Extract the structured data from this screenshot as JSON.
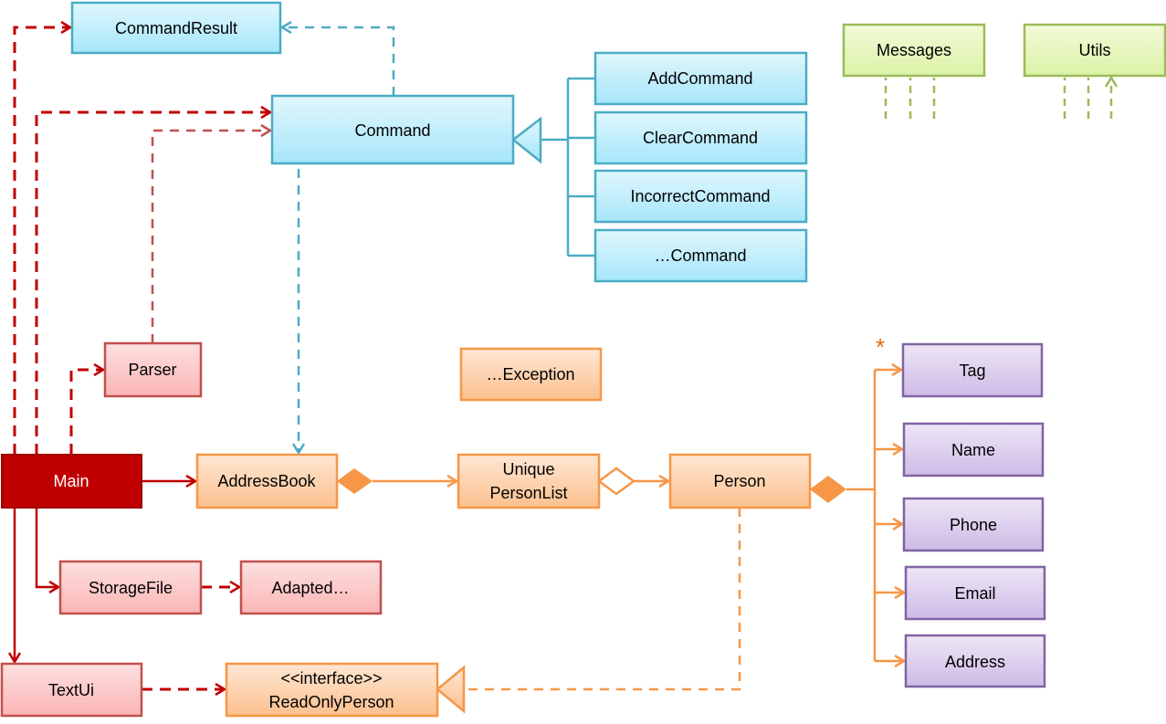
{
  "classes": {
    "command_result": "CommandResult",
    "command": "Command",
    "add_command": "AddCommand",
    "clear_command": "ClearCommand",
    "incorrect_command": "IncorrectCommand",
    "other_command": "…Command",
    "messages": "Messages",
    "utils": "Utils",
    "parser": "Parser",
    "exception": "…Exception",
    "main": "Main",
    "address_book": "AddressBook",
    "unique_person_list_line1": "Unique",
    "unique_person_list_line2": "PersonList",
    "person": "Person",
    "tag": "Tag",
    "name": "Name",
    "phone": "Phone",
    "email": "Email",
    "address": "Address",
    "storage_file": "StorageFile",
    "adapted": "Adapted…",
    "text_ui": "TextUi",
    "read_only_person_stereotype": "<<interface>>",
    "read_only_person": "ReadOnlyPerson"
  },
  "multiplicity_tag": "*",
  "colors": {
    "logic": "#4BACC6",
    "main_red": "#C00000",
    "ui_storage_red": "#C0504D",
    "model_orange": "#F79646",
    "attribute_purple": "#8064A2",
    "common_green": "#9BBB59"
  }
}
